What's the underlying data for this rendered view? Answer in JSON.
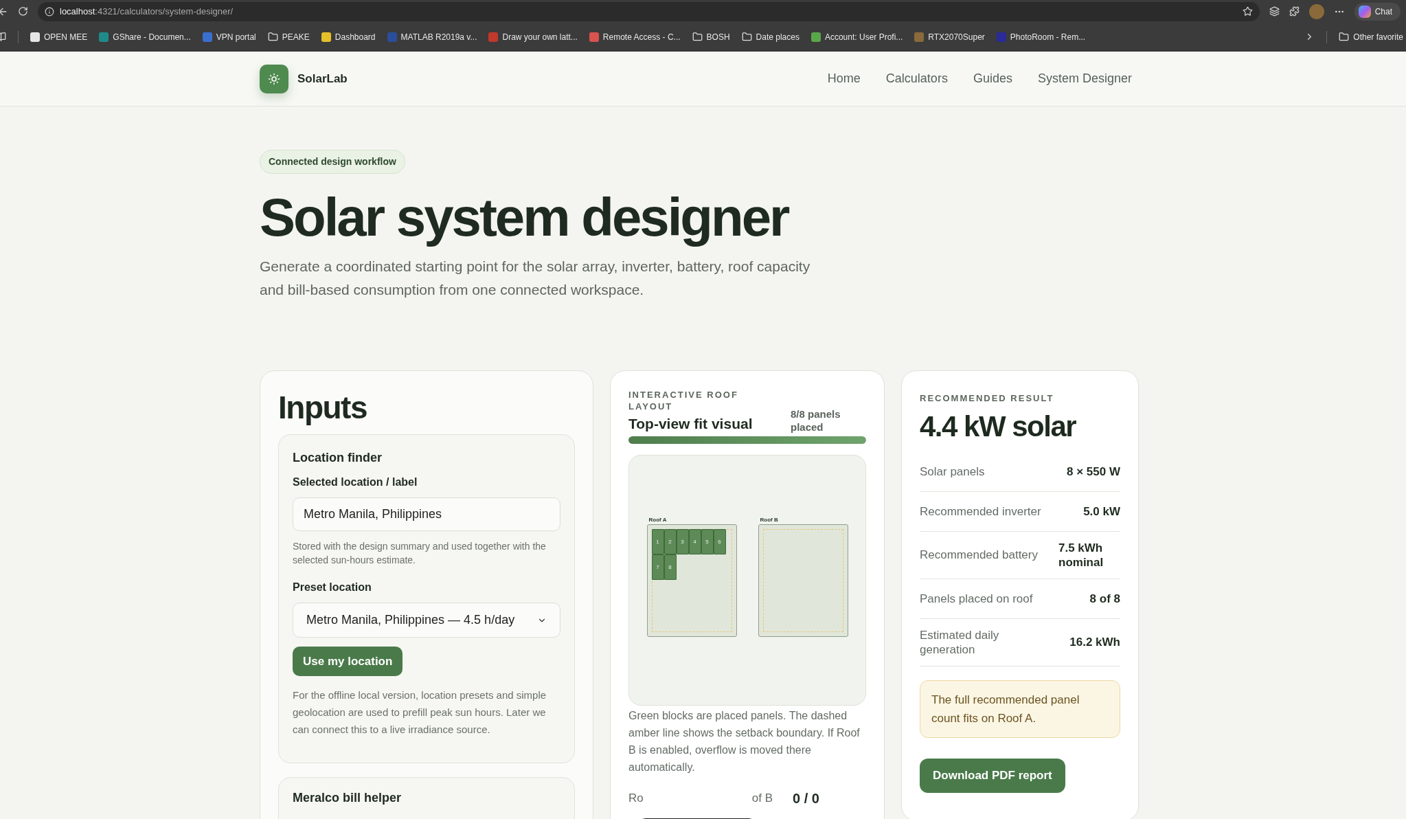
{
  "browser": {
    "url_host": "localhost",
    "url_path": ":4321/calculators/system-designer/",
    "chat_label": "Chat"
  },
  "bookmarks": [
    {
      "label": "OPEN MEE",
      "kind": "site",
      "color": "#e6e6e6"
    },
    {
      "label": "GShare - Documen...",
      "kind": "site",
      "color": "#1f8a8a"
    },
    {
      "label": "VPN portal",
      "kind": "site",
      "color": "#3a6fd0"
    },
    {
      "label": "PEAKE",
      "kind": "folder"
    },
    {
      "label": "Dashboard",
      "kind": "site",
      "color": "#e6c02a"
    },
    {
      "label": "MATLAB R2019a v...",
      "kind": "site",
      "color": "#2a4e9a"
    },
    {
      "label": "Draw your own latt...",
      "kind": "site",
      "color": "#c0392b"
    },
    {
      "label": "Remote Access - C...",
      "kind": "site",
      "color": "#d9534f"
    },
    {
      "label": "BOSH",
      "kind": "folder"
    },
    {
      "label": "Date places",
      "kind": "folder"
    },
    {
      "label": "Account: User Profi...",
      "kind": "site",
      "color": "#5aa64a"
    },
    {
      "label": "RTX2070Super",
      "kind": "site",
      "color": "#8a6a3a"
    },
    {
      "label": "PhotoRoom - Rem...",
      "kind": "site",
      "color": "#2a2a9a"
    }
  ],
  "other_favorites": "Other favorite",
  "site": {
    "brand": "SolarLab",
    "nav": [
      {
        "label": "Home"
      },
      {
        "label": "Calculators"
      },
      {
        "label": "Guides"
      },
      {
        "label": "System Designer"
      }
    ]
  },
  "hero": {
    "badge": "Connected design workflow",
    "title": "Solar system designer",
    "subtitle": "Generate a coordinated starting point for the solar array, inverter, battery, roof capacity and bill-based consumption from one connected workspace."
  },
  "inputs": {
    "title": "Inputs",
    "location_finder": {
      "title": "Location finder",
      "label_field": "Selected location / label",
      "value": "Metro Manila, Philippines",
      "hint": "Stored with the design summary and used together with the selected sun-hours estimate.",
      "preset_label": "Preset location",
      "preset_value": "Metro Manila, Philippines — 4.5 h/day",
      "button": "Use my location",
      "note": "For the offline local version, location presets and simple geolocation are used to prefill peak sun hours. Later we can connect this to a live irradiance source."
    },
    "next_section": "Meralco bill helper"
  },
  "roof_layout": {
    "eyebrow": "INTERACTIVE ROOF LAYOUT",
    "title": "Top-view fit visual",
    "placed_label": "8/8 panels placed",
    "level": 1,
    "roofs": [
      {
        "label": "Roof A",
        "panels": [
          "1",
          "2",
          "3",
          "4",
          "5",
          "6",
          "7",
          "8"
        ]
      },
      {
        "label": "Roof B"
      }
    ],
    "caption": "Green blocks are placed panels. The dashed amber line shows the setback boundary. If Roof B is enabled, overflow is moved there automatically.",
    "bottom_row": {
      "label_start": "Ro",
      "label_end": "of B",
      "value": "0 / 0"
    }
  },
  "result": {
    "eyebrow": "RECOMMENDED RESULT",
    "headline": "4.4 kW solar",
    "rows": [
      {
        "label": "Solar panels",
        "value": "8 × 550 W"
      },
      {
        "label": "Recommended inverter",
        "value": "5.0 kW"
      },
      {
        "label": "Recommended battery",
        "value": "7.5 kWh nominal"
      },
      {
        "label": "Panels placed on roof",
        "value": "8 of 8"
      },
      {
        "label": "Estimated daily generation",
        "value": "16.2 kWh"
      }
    ],
    "note": "The full recommended panel count fits on Roof A.",
    "button": "Download PDF report"
  }
}
